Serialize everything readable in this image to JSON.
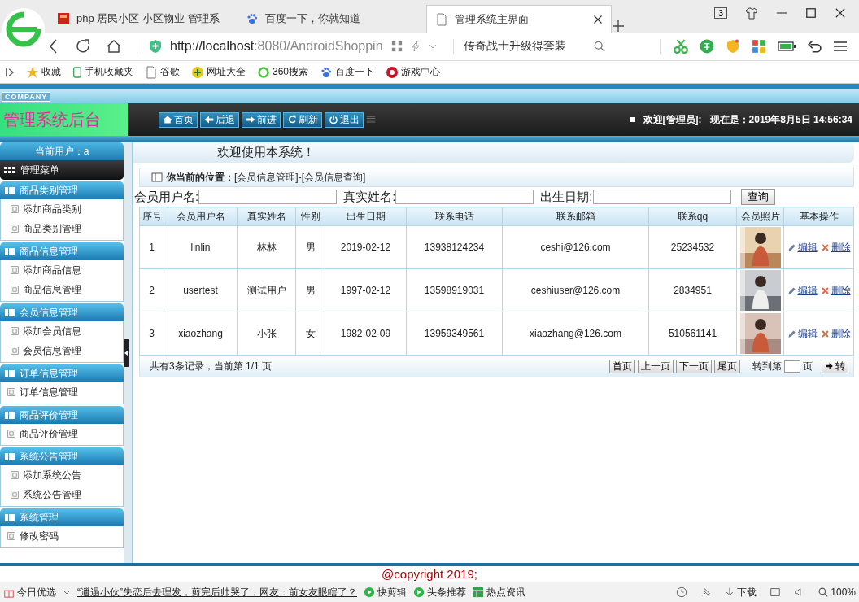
{
  "browser": {
    "tabs": [
      {
        "title": "php 居民小区 小区物业 管理系",
        "kind": "red",
        "selected": false
      },
      {
        "title": "百度一下，你就知道",
        "kind": "paw",
        "selected": false
      },
      {
        "title": "管理系统主界面",
        "kind": "page",
        "selected": true
      }
    ],
    "tab_count": "3",
    "address_host": "http://localhost",
    "address_rest": ":8080/AndroidShoppin",
    "search": "传奇战士升级得套装",
    "bookmarks": [
      {
        "label": "收藏",
        "kind": "star"
      },
      {
        "label": "手机收藏夹",
        "kind": "phone"
      },
      {
        "label": "谷歌",
        "kind": "page"
      },
      {
        "label": "网址大全",
        "kind": "plus"
      },
      {
        "label": "360搜索",
        "kind": "ring"
      },
      {
        "label": "百度一下",
        "kind": "paw"
      },
      {
        "label": "游戏中心",
        "kind": "game"
      }
    ]
  },
  "header": {
    "company": "COMPANY",
    "title": "管理系统后台",
    "nav": [
      {
        "label": "首页",
        "kind": "home"
      },
      {
        "label": "后退",
        "kind": "left"
      },
      {
        "label": "前进",
        "kind": "right"
      },
      {
        "label": "刷新",
        "kind": "refresh"
      },
      {
        "label": "退出",
        "kind": "power"
      }
    ],
    "welcome": "欢迎[管理员]:",
    "time": "现在是：2019年8月5日 14:56:34"
  },
  "sidebar": {
    "current_user": "当前用户：a",
    "menu_title": "管理菜单",
    "groups": [
      {
        "title": "商品类别管理",
        "items": [
          "添加商品类别",
          "商品类别管理"
        ]
      },
      {
        "title": "商品信息管理",
        "items": [
          "添加商品信息",
          "商品信息管理"
        ]
      },
      {
        "title": "会员信息管理",
        "items": [
          "添加会员信息",
          "会员信息管理"
        ]
      },
      {
        "title": "订单信息管理",
        "items": [
          "订单信息管理"
        ]
      },
      {
        "title": "商品评价管理",
        "items": [
          "商品评价管理"
        ]
      },
      {
        "title": "系统公告管理",
        "items": [
          "添加系统公告",
          "系统公告管理"
        ]
      },
      {
        "title": "系统管理",
        "items": [
          "修改密码"
        ]
      }
    ]
  },
  "welcome_banner": "欢迎使用本系统！",
  "breadcrumb": {
    "label": "你当前的位置：",
    "path": "[会员信息管理]-[会员信息查询]"
  },
  "filters": [
    {
      "label": "会员用户名:"
    },
    {
      "label": "真实姓名:"
    },
    {
      "label": "出生日期:"
    }
  ],
  "search_button": "查询",
  "table": {
    "columns": [
      "序号",
      "会员用户名",
      "真实姓名",
      "性别",
      "出生日期",
      "联系电话",
      "联系邮箱",
      "联系qq",
      "会员照片",
      "基本操作"
    ],
    "rows": [
      {
        "cells": [
          "1",
          "linlin",
          "林林",
          "男",
          "2019-02-12",
          "13938124234",
          "ceshi@126.com",
          "25234532"
        ],
        "actions": [
          "编辑",
          "删除"
        ]
      },
      {
        "cells": [
          "2",
          "usertest",
          "测试用户",
          "男",
          "1997-02-12",
          "13598919031",
          "ceshiuser@126.com",
          "2834951"
        ],
        "actions": [
          "编辑",
          "删除"
        ]
      },
      {
        "cells": [
          "3",
          "xiaozhang",
          "小张",
          "女",
          "1982-02-09",
          "13959349561",
          "xiaozhang@126.com",
          "510561141"
        ],
        "actions": [
          "编辑",
          "删除"
        ]
      }
    ]
  },
  "pager": {
    "summary": "共有3条记录，当前第 1/1 页",
    "buttons": [
      "首页",
      "上一页",
      "下一页",
      "尾页"
    ],
    "goto_label": "转到第",
    "goto_unit": "页",
    "go_button": "转"
  },
  "footer": "@copyright 2019;",
  "status_bar": {
    "left": "今日优选",
    "news": "“邋遢小伙”失恋后去理发，剪完后帅哭了，网友：前女友眼瞎了？",
    "items": [
      {
        "label": "快剪辑",
        "kind": "play"
      },
      {
        "label": "头条推荐",
        "kind": "play"
      },
      {
        "label": "热点资讯",
        "kind": "table"
      }
    ],
    "download": "下载",
    "zoom": "100%"
  }
}
